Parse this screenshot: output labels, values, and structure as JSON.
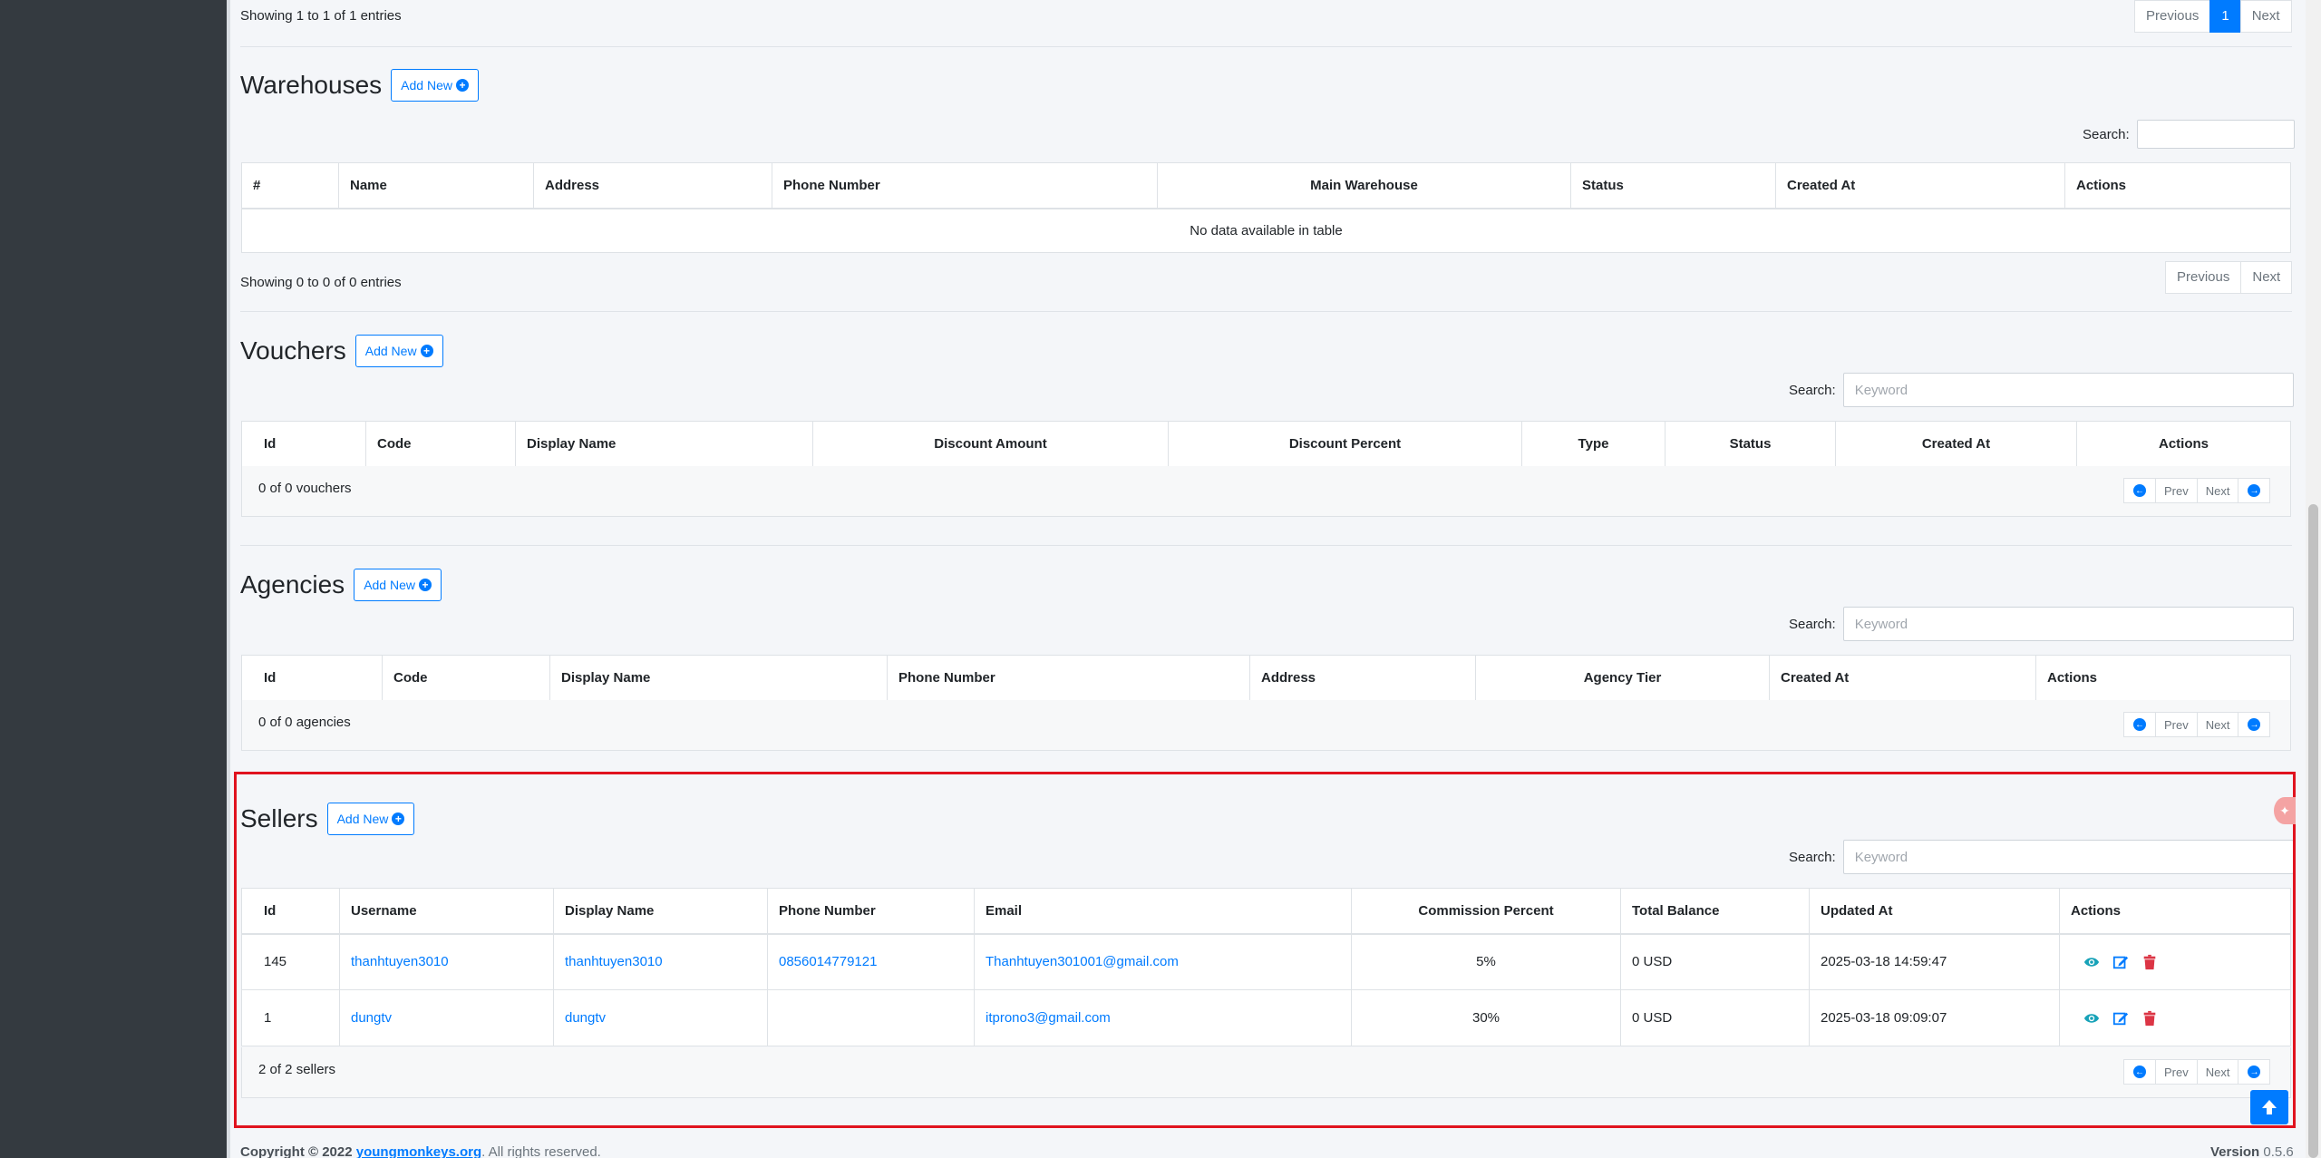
{
  "top": {
    "info": "Showing 1 to 1 of 1 entries",
    "pager": {
      "previous": "Previous",
      "page": "1",
      "next": "Next"
    }
  },
  "warehouses": {
    "title": "Warehouses",
    "add_new": "Add New",
    "search_label": "Search:",
    "columns": [
      "#",
      "Name",
      "Address",
      "Phone Number",
      "Main Warehouse",
      "Status",
      "Created At",
      "Actions"
    ],
    "empty": "No data available in table",
    "info": "Showing 0 to 0 of 0 entries",
    "pager": {
      "previous": "Previous",
      "next": "Next"
    }
  },
  "vouchers": {
    "title": "Vouchers",
    "add_new": "Add New",
    "search_label": "Search:",
    "search_placeholder": "Keyword",
    "columns": [
      "Id",
      "Code",
      "Display Name",
      "Discount Amount",
      "Discount Percent",
      "Type",
      "Status",
      "Created At",
      "Actions"
    ],
    "count": "0 of 0 vouchers",
    "prev": "Prev",
    "next": "Next"
  },
  "agencies": {
    "title": "Agencies",
    "add_new": "Add New",
    "search_label": "Search:",
    "search_placeholder": "Keyword",
    "columns": [
      "Id",
      "Code",
      "Display Name",
      "Phone Number",
      "Address",
      "Agency Tier",
      "Created At",
      "Actions"
    ],
    "count": "0 of 0 agencies",
    "prev": "Prev",
    "next": "Next"
  },
  "sellers": {
    "title": "Sellers",
    "add_new": "Add New",
    "search_label": "Search:",
    "search_placeholder": "Keyword",
    "columns": [
      "Id",
      "Username",
      "Display Name",
      "Phone Number",
      "Email",
      "Commission Percent",
      "Total Balance",
      "Updated At",
      "Actions"
    ],
    "rows": [
      {
        "id": "145",
        "username": "thanhtuyen3010",
        "display_name": "thanhtuyen3010",
        "phone": "0856014779121",
        "email": "Thanhtuyen301001@gmail.com",
        "commission": "5%",
        "balance": "0 USD",
        "updated": "2025-03-18 14:59:47"
      },
      {
        "id": "1",
        "username": "dungtv",
        "display_name": "dungtv",
        "phone": "",
        "email": "itprono3@gmail.com",
        "commission": "30%",
        "balance": "0 USD",
        "updated": "2025-03-18 09:09:07"
      }
    ],
    "count": "2 of 2 sellers",
    "prev": "Prev",
    "next": "Next"
  },
  "footer": {
    "copyright": "Copyright © 2022",
    "link": "youngmonkeys.org",
    "rights": ". All rights reserved.",
    "version_label": "Version",
    "version": "0.5.6"
  },
  "colors": {
    "primary": "#007bff",
    "danger": "#dc3545",
    "highlight": "#e0131f",
    "sidebar": "#343a40"
  }
}
